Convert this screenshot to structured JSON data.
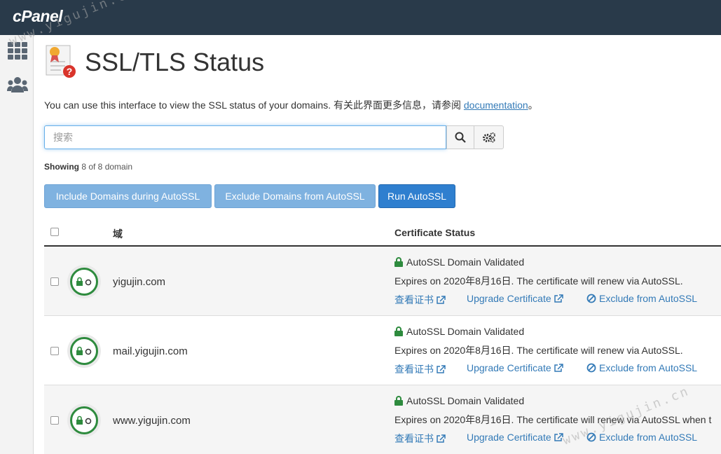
{
  "header": {
    "logo": "cPanel"
  },
  "page": {
    "title": "SSL/TLS Status",
    "intro_text": "You can use this interface to view the SSL status of your domains. 有关此界面更多信息，请参阅 ",
    "doc_link": "documentation",
    "intro_end": "。"
  },
  "search": {
    "placeholder": "搜索"
  },
  "showing": {
    "label": "Showing",
    "text": " 8 of 8 domain"
  },
  "buttons": {
    "include": "Include Domains during AutoSSL",
    "exclude": "Exclude Domains from AutoSSL",
    "run": "Run AutoSSL"
  },
  "table": {
    "col_domain": "域",
    "col_status": "Certificate Status",
    "rows": [
      {
        "domain": "yigujin.com",
        "status": "AutoSSL Domain Validated",
        "expires": "Expires on 2020年8月16日. The certificate will renew via AutoSSL.",
        "view_cert": "查看证书",
        "upgrade": "Upgrade Certificate",
        "exclude": "Exclude from AutoSSL"
      },
      {
        "domain": "mail.yigujin.com",
        "status": "AutoSSL Domain Validated",
        "expires": "Expires on 2020年8月16日. The certificate will renew via AutoSSL.",
        "view_cert": "查看证书",
        "upgrade": "Upgrade Certificate",
        "exclude": "Exclude from AutoSSL"
      },
      {
        "domain": "www.yigujin.com",
        "status": "AutoSSL Domain Validated",
        "expires": "Expires on 2020年8月16日. The certificate will renew via AutoSSL when t",
        "view_cert": "查看证书",
        "upgrade": "Upgrade Certificate",
        "exclude": "Exclude from AutoSSL"
      }
    ]
  },
  "watermark": "www.yigujin.cn",
  "colors": {
    "topbar": "#293a4a",
    "primary": "#2f7fcf",
    "link": "#337ab7",
    "valid_green": "#2e8b3e"
  },
  "icons": [
    "grid-icon",
    "users-icon",
    "certificate-icon",
    "search-icon",
    "settings-icon",
    "lock-icon",
    "external-link-icon",
    "ban-icon"
  ]
}
